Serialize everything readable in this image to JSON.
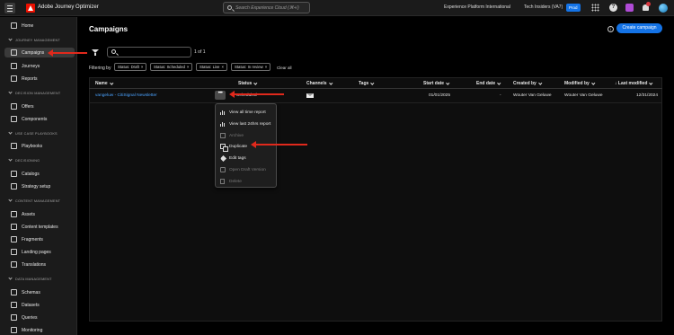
{
  "topbar": {
    "app_name": "Adobe Journey Optimizer",
    "search_placeholder": "Search Experience Cloud (⌘+/)",
    "org_name": "Experience Platform International",
    "sandbox_name": "Tech Insiders (VA7)",
    "sandbox_badge": "Prod",
    "help_glyph": "?",
    "icons": [
      "hamburger-menu-icon",
      "adobe-logo-icon",
      "search-icon",
      "apps-grid-icon",
      "help-icon",
      "feedback-icon",
      "notifications-bell-icon",
      "user-avatar-icon"
    ]
  },
  "sidebar": {
    "items": [
      {
        "label": "Home",
        "icon": "home-icon"
      },
      {
        "section": "JOURNEY MANAGEMENT"
      },
      {
        "label": "Campaigns",
        "icon": "campaigns-icon",
        "active": true
      },
      {
        "label": "Journeys",
        "icon": "journeys-icon"
      },
      {
        "label": "Reports",
        "icon": "reports-icon"
      },
      {
        "section": "DECISION MANAGEMENT"
      },
      {
        "label": "Offers",
        "icon": "offers-icon"
      },
      {
        "label": "Components",
        "icon": "components-icon"
      },
      {
        "section": "USE CASE PLAYBOOKS"
      },
      {
        "label": "Playbooks",
        "icon": "playbooks-icon"
      },
      {
        "section": "DECISIONING"
      },
      {
        "label": "Catalogs",
        "icon": "catalogs-icon"
      },
      {
        "label": "Strategy setup",
        "icon": "strategy-setup-icon"
      },
      {
        "section": "CONTENT MANAGEMENT"
      },
      {
        "label": "Assets",
        "icon": "assets-icon"
      },
      {
        "label": "Content templates",
        "icon": "content-templates-icon"
      },
      {
        "label": "Fragments",
        "icon": "fragments-icon"
      },
      {
        "label": "Landing pages",
        "icon": "landing-pages-icon"
      },
      {
        "label": "Translations",
        "icon": "translations-icon"
      },
      {
        "section": "DATA MANAGEMENT"
      },
      {
        "label": "Schemas",
        "icon": "schemas-icon"
      },
      {
        "label": "Datasets",
        "icon": "datasets-icon"
      },
      {
        "label": "Queries",
        "icon": "queries-icon"
      },
      {
        "label": "Monitoring",
        "icon": "monitoring-icon"
      }
    ]
  },
  "main": {
    "title": "Campaigns",
    "info_glyph": "i",
    "create_button": "Create campaign",
    "search_value": "",
    "result_count": "1 of 1",
    "filtering_label": "Filtering by",
    "filters": [
      "Status: Draft",
      "Status: Scheduled",
      "Status: Live",
      "Status: In review"
    ],
    "filter_remove_glyph": "×",
    "clear_all": "Clear all",
    "table": {
      "columns": [
        "Name",
        "Status",
        "Channels",
        "Tags",
        "Start date",
        "End date",
        "Created by",
        "Modified by",
        "Last modified"
      ],
      "sort_glyph": "↓",
      "rows": [
        {
          "name": "vangeluw - CitiSignal Newsletter",
          "status": "Scheduled",
          "channel_icon": "email-icon",
          "tags": "",
          "start_date": "01/01/2025",
          "end_date": "-",
          "created_by": "Wouter Van Geluwe",
          "modified_by": "Wouter Van Geluwe",
          "last_modified": "12/31/2024"
        }
      ],
      "more_actions_glyph": "•••"
    },
    "context_menu": [
      {
        "label": "View all time report",
        "icon": "report-chart-icon",
        "enabled": true
      },
      {
        "label": "View last 24hrs report",
        "icon": "report-chart-icon",
        "enabled": true
      },
      {
        "label": "Archive",
        "icon": "archive-icon",
        "enabled": false
      },
      {
        "label": "Duplicate",
        "icon": "duplicate-icon",
        "enabled": true,
        "highlighted": true
      },
      {
        "label": "Edit tags",
        "icon": "tag-icon",
        "enabled": true
      },
      {
        "label": "Open Draft Version",
        "icon": "open-draft-icon",
        "enabled": false
      },
      {
        "label": "Delete",
        "icon": "delete-icon",
        "enabled": false
      }
    ]
  },
  "colors": {
    "accent": "#1473e6",
    "link": "#4ba3ff",
    "annotation_arrow": "#e0291c",
    "background": "#000000",
    "panel": "#1b1b1b"
  }
}
